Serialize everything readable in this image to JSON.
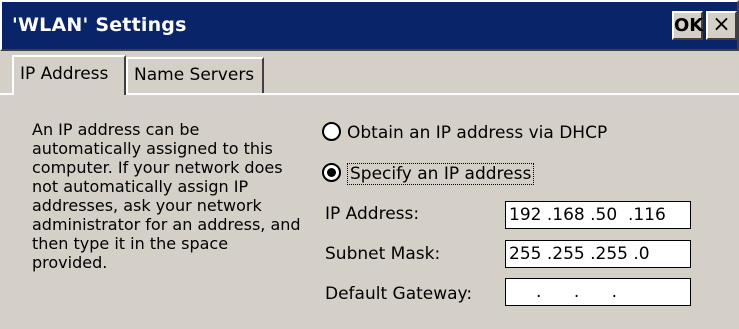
{
  "window": {
    "title": "'WLAN' Settings",
    "ok_label": "OK",
    "close_label": "×"
  },
  "tabs": [
    {
      "label": "IP Address",
      "selected": true
    },
    {
      "label": "Name Servers",
      "selected": false
    }
  ],
  "description": "An IP address can be automatically assigned to this computer.  If your network does not automatically assign IP addresses, ask your network administrator for an address, and then type it in the space provided.",
  "options": {
    "dhcp_label": "Obtain an IP address via DHCP",
    "dhcp_selected": false,
    "specify_label": "Specify an IP address",
    "specify_selected": true
  },
  "fields": {
    "ip_label": "IP Address:",
    "ip_value": "192 .168 .50  .116",
    "subnet_label": "Subnet Mask:",
    "subnet_value": "255 .255 .255 .0",
    "gateway_label": "Default Gateway:",
    "gateway_value": "     .      .      ."
  }
}
